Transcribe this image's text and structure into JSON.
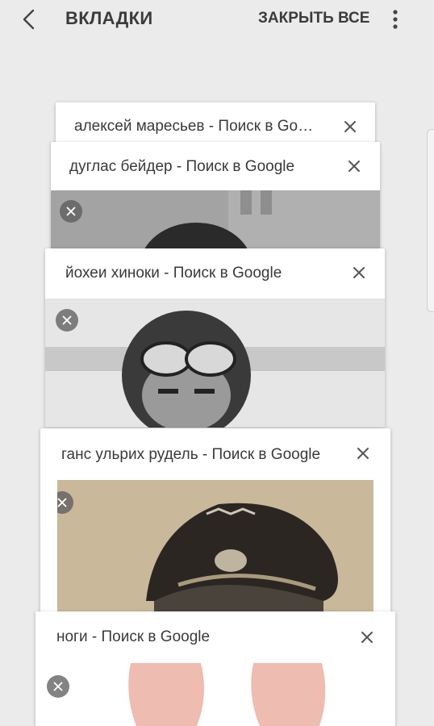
{
  "header": {
    "title": "ВКЛАДКИ",
    "close_all": "ЗАКРЫТЬ ВСЕ"
  },
  "icons": {
    "back": "chevron-left-icon",
    "more": "more-vertical-icon",
    "close": "close-icon"
  },
  "tabs": [
    {
      "title": "алексей маресьев - Поиск в Google"
    },
    {
      "title": "дуглас бейдер - Поиск в Google"
    },
    {
      "title": "йохеи хиноки - Поиск в Google"
    },
    {
      "title": "ганс ульрих рудель - Поиск в Google"
    },
    {
      "title": "ноги - Поиск в Google"
    }
  ],
  "colors": {
    "background": "#ebebeb",
    "card": "#ffffff",
    "text": "#3a3a3a"
  }
}
